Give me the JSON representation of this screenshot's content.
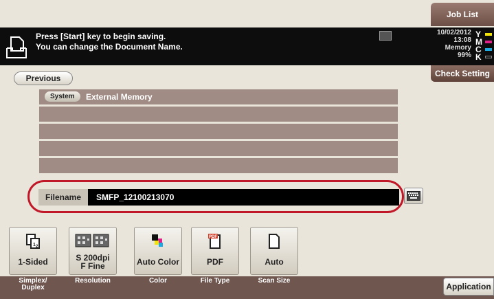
{
  "header": {
    "job_list_label": "Job List",
    "message_line1": "Press [Start] key to begin saving.",
    "message_line2": "You can change the Document Name.",
    "date": "10/02/2012",
    "time": "13:08",
    "memory_label": "Memory",
    "memory_value": "99%",
    "toner": [
      {
        "letter": "Y",
        "color": "#f2e40a"
      },
      {
        "letter": "M",
        "color": "#e0218a"
      },
      {
        "letter": "C",
        "color": "#1fa9e1"
      },
      {
        "letter": "K",
        "color": "#1a1a1a"
      }
    ],
    "check_setting_label": "Check Setting"
  },
  "nav": {
    "previous_label": "Previous"
  },
  "folder_list": {
    "badge": "System",
    "path": "External Memory"
  },
  "filename": {
    "label": "Filename",
    "value": "SMFP_12100213070"
  },
  "functions": [
    {
      "label": "1-Sided",
      "category": "Simplex/\nDuplex",
      "icon": "simplex-icon"
    },
    {
      "label": "S 200dpi\nF Fine",
      "category": "Resolution",
      "icon": "resolution-icon"
    },
    {
      "label": "Auto Color",
      "category": "Color",
      "icon": "color-icon"
    },
    {
      "label": "PDF",
      "category": "File Type",
      "icon": "pdf-icon"
    },
    {
      "label": "Auto",
      "category": "Scan Size",
      "icon": "scan-size-icon"
    }
  ],
  "application_label": "Application"
}
